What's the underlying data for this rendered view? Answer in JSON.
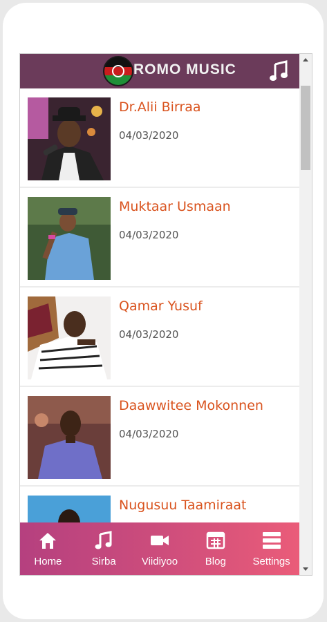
{
  "app": {
    "title": "ROMO MUSIC",
    "logo_colors": [
      "#000000",
      "#cc1f1f",
      "#1f9a3a"
    ],
    "header_color": "#6b3b5a",
    "accent_color": "#d9531e"
  },
  "header": {
    "music_icon": "music-note-icon"
  },
  "artists": [
    {
      "name": "Dr.Alii Birraa",
      "date": "04/03/2020"
    },
    {
      "name": "Muktaar Usmaan",
      "date": "04/03/2020"
    },
    {
      "name": "Qamar Yusuf",
      "date": "04/03/2020"
    },
    {
      "name": "Daawwitee Mokonnen",
      "date": "04/03/2020"
    },
    {
      "name": "Nugusuu Taamiraat",
      "date": ""
    }
  ],
  "nav": {
    "items": [
      {
        "label": "Home",
        "icon": "home-icon"
      },
      {
        "label": "Sirba",
        "icon": "music-note-icon"
      },
      {
        "label": "Viidiyoo",
        "icon": "video-camera-icon"
      },
      {
        "label": "Blog",
        "icon": "blog-icon"
      },
      {
        "label": "Settings",
        "icon": "menu-icon"
      }
    ]
  }
}
